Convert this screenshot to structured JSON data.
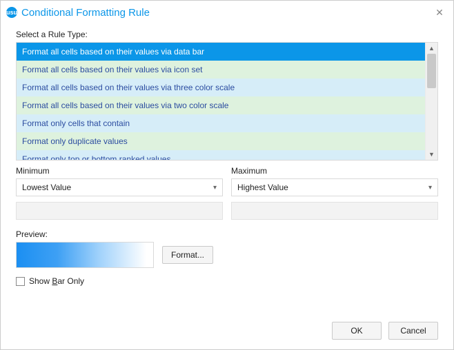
{
  "header": {
    "title": "Conditional Formatting Rule",
    "app_icon_text": "usu"
  },
  "labels": {
    "select_rule_type": "Select a Rule Type:",
    "minimum": "Minimum",
    "maximum": "Maximum",
    "preview": "Preview:"
  },
  "rule_types": [
    "Format all cells based on their values via data bar",
    "Format all cells based on their values via icon set",
    "Format all cells based on their values via three color scale",
    "Format all cells based on their values via two color scale",
    "Format only cells that contain",
    "Format only duplicate values",
    "Format only top or bottom ranked values"
  ],
  "selected_rule_index": 0,
  "minimum": {
    "type_value": "Lowest Value"
  },
  "maximum": {
    "type_value": "Highest Value"
  },
  "buttons": {
    "format": "Format...",
    "ok": "OK",
    "cancel": "Cancel"
  },
  "checkbox": {
    "prefix": "Show ",
    "accel": "B",
    "suffix": "ar Only",
    "checked": false
  }
}
